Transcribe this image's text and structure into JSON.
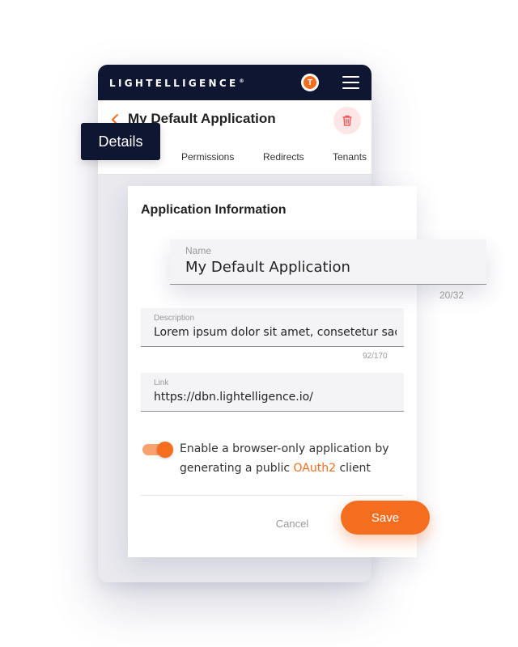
{
  "header": {
    "brand": "LIGHTELLIGENCE",
    "brand_mark": "®",
    "avatar_initial": "T"
  },
  "titlebar": {
    "title": "My Default Application"
  },
  "tabs": [
    {
      "label": "Details"
    },
    {
      "label": "Permissions"
    },
    {
      "label": "Redirects"
    },
    {
      "label": "Tenants"
    }
  ],
  "card": {
    "title": "Application Information",
    "name": {
      "label": "Name",
      "value": "My Default Application",
      "counter": "20/32"
    },
    "description": {
      "label": "Description",
      "value": "Lorem ipsum dolor sit amet, consetetur sad",
      "counter": "92/170"
    },
    "link": {
      "label": "Link",
      "value": "https://dbn.lightelligence.io/"
    },
    "toggle": {
      "on": true,
      "text_before": "Enable a browser-only application by generating a public ",
      "link_text": "OAuth2",
      "text_after": " client"
    },
    "cancel_label": "Cancel",
    "save_label": "Save"
  },
  "colors": {
    "accent": "#f56d1f",
    "navy": "#0f1631",
    "delete_bg": "#fde6e6"
  }
}
